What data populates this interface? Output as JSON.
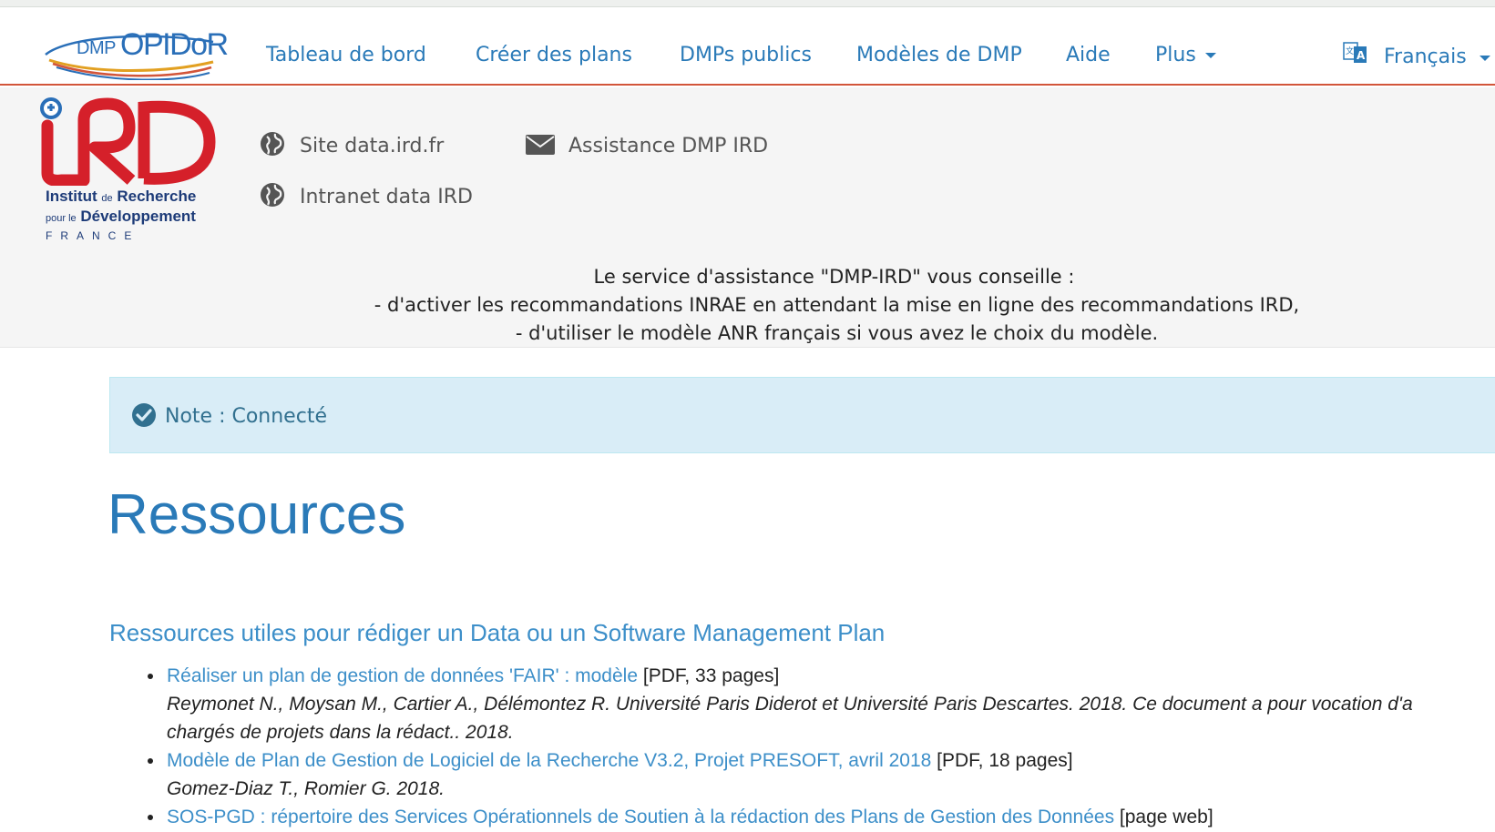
{
  "header": {
    "logo_prefix": "DMP",
    "logo_name": "OPIDoR",
    "nav": [
      {
        "label": "Tableau de bord"
      },
      {
        "label": "Créer des plans"
      },
      {
        "label": "DMPs publics"
      },
      {
        "label": "Modèles de DMP"
      },
      {
        "label": "Aide"
      },
      {
        "label": "Plus"
      }
    ],
    "language": "Français"
  },
  "institution": {
    "logo_line1_a": "Institut",
    "logo_line1_b": "de",
    "logo_line1_c": "Recherche",
    "logo_line2_a": "pour le",
    "logo_line2_b": "Développement",
    "logo_country": "FRANCE",
    "links": [
      {
        "label": "Site data.ird.fr",
        "icon": "globe-icon"
      },
      {
        "label": "Intranet data IRD",
        "icon": "globe-icon"
      },
      {
        "label": "Assistance DMP IRD",
        "icon": "envelope-icon"
      }
    ],
    "advice": [
      "Le service d'assistance \"DMP-IRD\" vous conseille :",
      "- d'activer les recommandations INRAE en attendant la mise en ligne des recommandations IRD,",
      "- d'utiliser le modèle ANR français si vous avez le choix du modèle."
    ]
  },
  "notice": {
    "text": "Note : Connecté",
    "icon": "check-circle-icon"
  },
  "main": {
    "title": "Ressources",
    "section_title": "Ressources utiles pour rédiger un Data ou un Software Management Plan",
    "resources": [
      {
        "link": "Réaliser un plan de gestion de données 'FAIR' : modèle",
        "meta": "[PDF, 33 pages]",
        "desc1": "Reymonet N., Moysan M., Cartier A., Délémontez R. Université Paris Diderot et Université Paris Descartes. 2018. Ce document a pour vocation d'a",
        "desc2": "chargés de projets dans la rédact.. 2018."
      },
      {
        "link": "Modèle de Plan de Gestion de Logiciel de la Recherche V3.2, Projet PRESOFT, avril 2018",
        "meta": "[PDF, 18 pages]",
        "desc1": "Gomez-Diaz T., Romier G. 2018."
      },
      {
        "link": "SOS-PGD : répertoire des Services Opérationnels de Soutien à la rédaction des Plans de Gestion des Données",
        "meta": "[page web]"
      }
    ]
  },
  "colors": {
    "link": "#2a7ab8",
    "nav_border": "#d2553a",
    "ird_red": "#d5202a",
    "ird_blue": "#1d3b78",
    "notice_bg": "#d9edf7",
    "notice_text": "#31708f"
  }
}
